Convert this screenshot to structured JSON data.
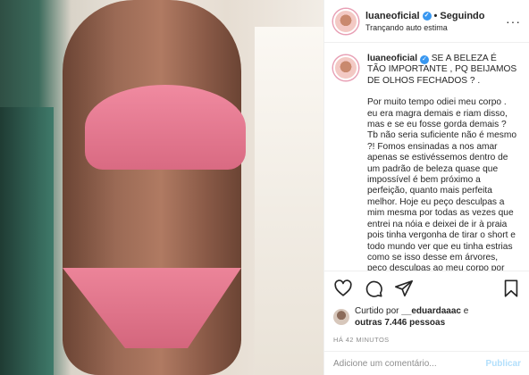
{
  "post": {
    "username": "luaneoficial",
    "follow_status": "Seguindo",
    "dot": "•",
    "location": "Trançando auto estima",
    "more_icon": "more-horizontal-icon",
    "more_glyph": "···"
  },
  "caption": {
    "username": "luaneoficial",
    "intro": "SE A BELEZA É TÃO IMPORTANTE , PQ BEIJAMOS DE OLHOS FECHADOS ? .",
    "body": "Por muito tempo odiei meu corpo . eu era magra demais e riam disso, mas e se eu fosse gorda demais ? Tb não seria suficiente não é mesmo ?! Fomos ensinadas a nos amar apenas se estivéssemos dentro de um padrão de beleza quase que impossível é bem próximo a perfeição, quanto mais perfeita melhor. Hoje eu peço desculpas a mim mesma por todas as vezes que entrei na nóia e deixei de ir à praia pois tinha vergonha de tirar o short e todo mundo ver que eu tinha estrias como se isso desse em árvores, peço desculpas ao meu corpo por"
  },
  "actions": {
    "icons": [
      "heart-icon",
      "comment-icon",
      "share-icon",
      "bookmark-icon"
    ]
  },
  "likes": {
    "prefix": "Curtido por ",
    "user": "__eduardaaac",
    "middle": " e",
    "others": "outras 7.446 pessoas"
  },
  "timestamp": "HÁ 42 MINUTOS",
  "comment": {
    "placeholder": "Adicione um comentário...",
    "publish_label": "Publicar"
  },
  "colors": {
    "verified": "#3897f0",
    "publish_disabled": "#b2dffc",
    "muted_text": "#8e8e8e",
    "border": "#efefef"
  }
}
